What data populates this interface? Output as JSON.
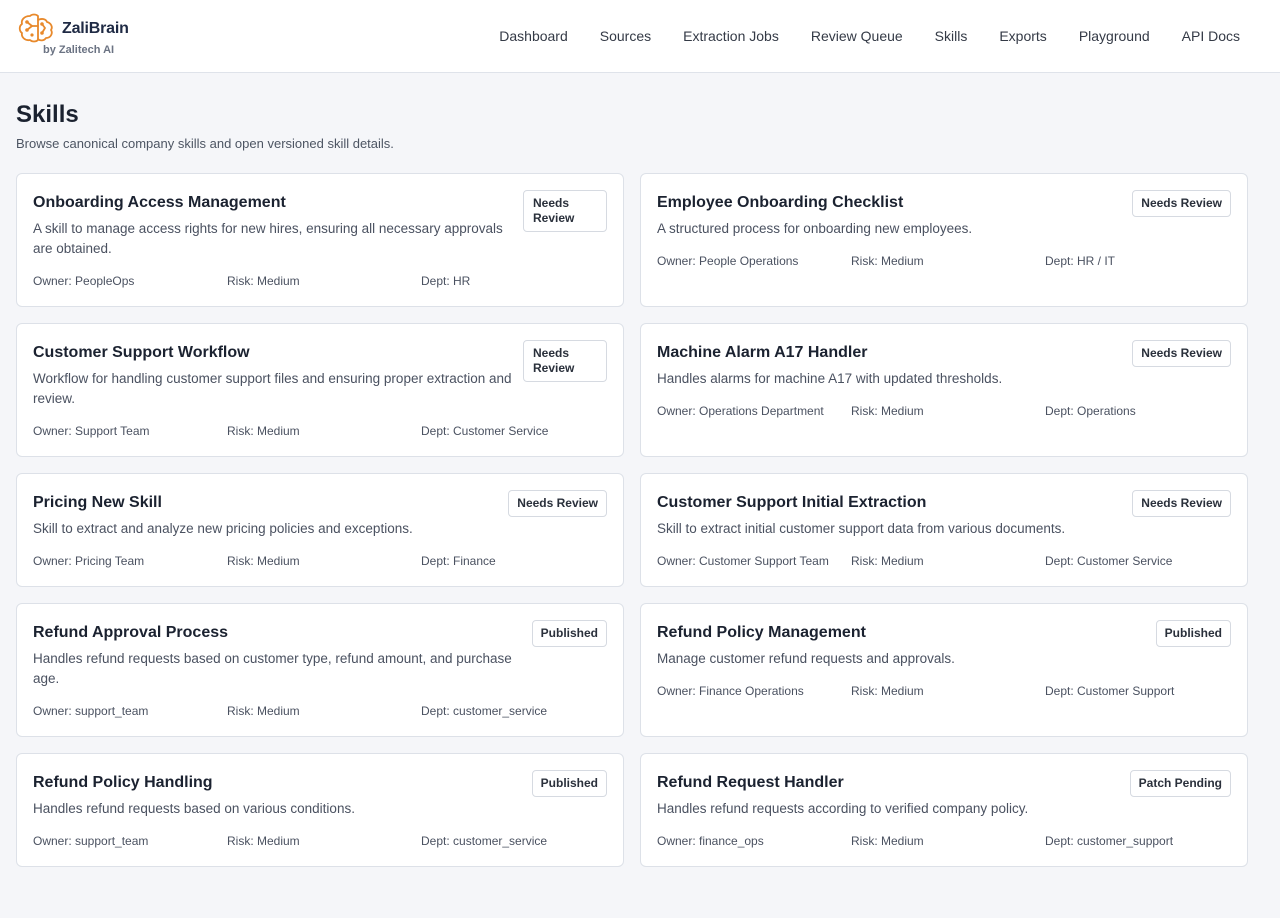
{
  "brand": {
    "name": "ZaliBrain",
    "sub": "by Zalitech AI",
    "accent": "#e8892b"
  },
  "nav": {
    "dashboard": "Dashboard",
    "sources": "Sources",
    "extraction_jobs": "Extraction Jobs",
    "review_queue": "Review Queue",
    "skills": "Skills",
    "exports": "Exports",
    "playground": "Playground",
    "api_docs": "API Docs"
  },
  "page": {
    "title": "Skills",
    "subtitle": "Browse canonical company skills and open versioned skill details."
  },
  "skills": [
    {
      "title": "Onboarding Access Management",
      "description": "A skill to manage access rights for new hires, ensuring all necessary approvals are obtained.",
      "status": "Needs Review",
      "owner": "Owner: PeopleOps",
      "risk": "Risk: Medium",
      "dept": "Dept: HR"
    },
    {
      "title": "Employee Onboarding Checklist",
      "description": "A structured process for onboarding new employees.",
      "status": "Needs Review",
      "owner": "Owner: People Operations",
      "risk": "Risk: Medium",
      "dept": "Dept: HR / IT"
    },
    {
      "title": "Customer Support Workflow",
      "description": "Workflow for handling customer support files and ensuring proper extraction and review.",
      "status": "Needs Review",
      "owner": "Owner: Support Team",
      "risk": "Risk: Medium",
      "dept": "Dept: Customer Service"
    },
    {
      "title": "Machine Alarm A17 Handler",
      "description": "Handles alarms for machine A17 with updated thresholds.",
      "status": "Needs Review",
      "owner": "Owner: Operations Department",
      "risk": "Risk: Medium",
      "dept": "Dept: Operations"
    },
    {
      "title": "Pricing New Skill",
      "description": "Skill to extract and analyze new pricing policies and exceptions.",
      "status": "Needs Review",
      "owner": "Owner: Pricing Team",
      "risk": "Risk: Medium",
      "dept": "Dept: Finance"
    },
    {
      "title": "Customer Support Initial Extraction",
      "description": "Skill to extract initial customer support data from various documents.",
      "status": "Needs Review",
      "owner": "Owner: Customer Support Team",
      "risk": "Risk: Medium",
      "dept": "Dept: Customer Service"
    },
    {
      "title": "Refund Approval Process",
      "description": "Handles refund requests based on customer type, refund amount, and purchase age.",
      "status": "Published",
      "owner": "Owner: support_team",
      "risk": "Risk: Medium",
      "dept": "Dept: customer_service"
    },
    {
      "title": "Refund Policy Management",
      "description": "Manage customer refund requests and approvals.",
      "status": "Published",
      "owner": "Owner: Finance Operations",
      "risk": "Risk: Medium",
      "dept": "Dept: Customer Support"
    },
    {
      "title": "Refund Policy Handling",
      "description": "Handles refund requests based on various conditions.",
      "status": "Published",
      "owner": "Owner: support_team",
      "risk": "Risk: Medium",
      "dept": "Dept: customer_service"
    },
    {
      "title": "Refund Request Handler",
      "description": "Handles refund requests according to verified company policy.",
      "status": "Patch Pending",
      "owner": "Owner: finance_ops",
      "risk": "Risk: Medium",
      "dept": "Dept: customer_support"
    }
  ]
}
